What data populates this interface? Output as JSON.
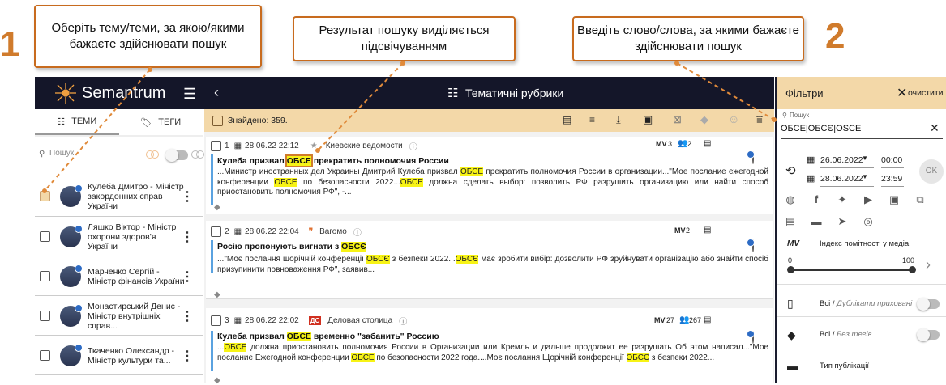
{
  "callouts": {
    "c1": "Оберіть тему/теми, за якою/якими бажаєте здійснювати пошук",
    "c2": "Результат пошуку виділяється підсвічуванням",
    "c3": "Введіть слово/слова, за якими бажаєте здійснювати пошук",
    "n1": "1",
    "n2": "2"
  },
  "header": {
    "logo": "Semantrum",
    "title": "Тематичні рубрики"
  },
  "left": {
    "tab_topics": "ТЕМИ",
    "tab_tags": "ТЕГИ",
    "search_placeholder": "Пошук",
    "people": [
      "Кулеба Дмитро - Міністр закордонних справ України",
      "Ляшко Віктор - Міністр охорони здоров'я України",
      "Марченко Сергій - Міністр фінансів України",
      "Монастирський Денис - Міністр внутрішніх справ...",
      "Ткаченко Олександр - Міністр культури та..."
    ]
  },
  "results": {
    "found": "Знайдено: 359.",
    "items": [
      {
        "num": "1",
        "date": "28.06.22 22:12",
        "source": "Киевские ведомости",
        "mv": "3",
        "people": "2",
        "title_pre": "Кулеба призвал ",
        "title_hl": "ОБСЕ",
        "title_post": " прекратить полномочия России",
        "body": [
          {
            "t": "...Министр иностранных дел Украины Дмитрий Кулеба призвал "
          },
          {
            "t": "ОБСЕ",
            "h": true
          },
          {
            "t": " прекратить полномочия России в организации...\"Мое послание ежегодной конференции "
          },
          {
            "t": "ОБСЕ",
            "h": true
          },
          {
            "t": " по безопасности 2022..."
          },
          {
            "t": "ОБСЕ",
            "h": true
          },
          {
            "t": " должна сделать выбор: позволить РФ разрушить организацию или найти способ приостановить полномочия РФ\", -..."
          }
        ]
      },
      {
        "num": "2",
        "date": "28.06.22 22:04",
        "source": "Вагомо",
        "mv": "2",
        "people": "",
        "title_pre": "Росію пропонують вигнати з ",
        "title_hl": "ОБСЄ",
        "title_post": "",
        "body": [
          {
            "t": "...\"Моє послання щорічній конференції "
          },
          {
            "t": "ОБСЄ",
            "h": true
          },
          {
            "t": " з безпеки 2022..."
          },
          {
            "t": "ОБСЄ",
            "h": true
          },
          {
            "t": " має зробити вибір: дозволити РФ зруйнувати організацію або знайти спосіб призупинити повноваження РФ\", заявив..."
          }
        ]
      },
      {
        "num": "3",
        "date": "28.06.22 22:02",
        "source": "Деловая столица",
        "mv": "27",
        "people": "267",
        "title_pre": "Кулеба призвал ",
        "title_hl": "ОБСЕ",
        "title_post": " временно \"забанить\" Россию",
        "body": [
          {
            "t": "..."
          },
          {
            "t": "ОБСЕ",
            "h": true
          },
          {
            "t": " должна приостановить полномочия России в Организации или Кремль и дальше продолжит ее разрушать Об этом написал...\"Мое послание Ежегодной конференции "
          },
          {
            "t": "ОБСЕ",
            "h": true
          },
          {
            "t": " по безопасности 2022 года....Моє послання Щорічній конференції "
          },
          {
            "t": "ОБСЄ",
            "h": true
          },
          {
            "t": " з безпеки 2022..."
          }
        ]
      }
    ]
  },
  "filters": {
    "title": "Фільтри",
    "clear": "очистити",
    "search_label": "Пошук",
    "search_value": "ОБСЕ|ОБСЄ|OSCE",
    "date_from": "26.06.2022",
    "time_from": "00:00",
    "date_to": "28.06.2022",
    "time_to": "23:59",
    "ok": "OK",
    "mv": "MV",
    "media_index": "Індекс помітності у медіа",
    "range_min": "0",
    "range_max": "100",
    "dup_all": "Всі",
    "dup_label": "Дублікати приховані",
    "tags_all": "Всі",
    "tags_label": "Без тегів",
    "pub_type": "Тип публікації"
  }
}
